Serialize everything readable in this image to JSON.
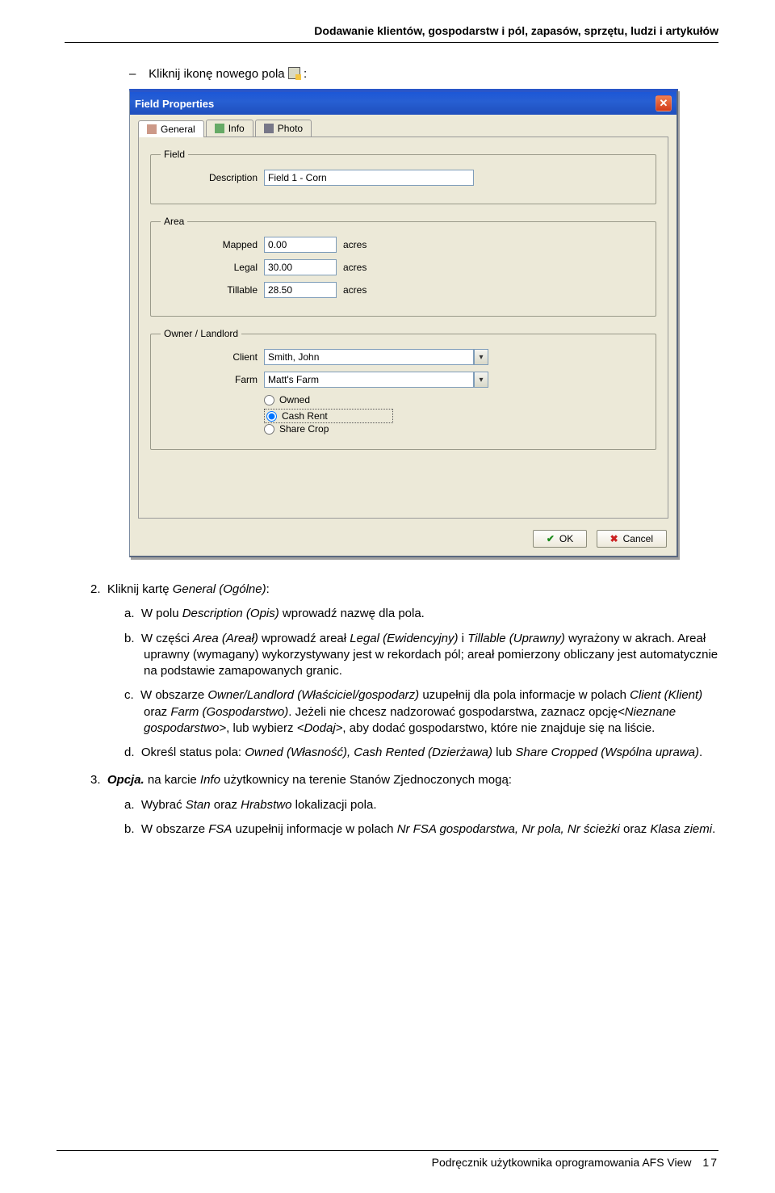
{
  "header": "Dodawanie klientów, gospodarstw i pól, zapasów, sprzętu, ludzi i artykułów",
  "intro": {
    "prefix": "Kliknij ikonę nowego pola",
    "suffix": ":"
  },
  "dialog": {
    "title": "Field Properties",
    "tabs": {
      "general": "General",
      "info": "Info",
      "photo": "Photo"
    },
    "groups": {
      "field": "Field",
      "area": "Area",
      "owner": "Owner / Landlord"
    },
    "labels": {
      "description": "Description",
      "mapped": "Mapped",
      "legal": "Legal",
      "tillable": "Tillable",
      "client": "Client",
      "farm": "Farm"
    },
    "values": {
      "description": "Field 1 - Corn",
      "mapped": "0.00",
      "legal": "30.00",
      "tillable": "28.50",
      "client": "Smith, John",
      "farm": "Matt's Farm"
    },
    "unit": "acres",
    "radios": {
      "owned": "Owned",
      "cashrent": "Cash Rent",
      "sharecrop": "Share Crop"
    },
    "buttons": {
      "ok": "OK",
      "cancel": "Cancel"
    }
  },
  "body": {
    "n2": "2.",
    "t2a": "Kliknij kartę ",
    "t2b": "General (Ogólne)",
    "t2c": ":",
    "na": "a.",
    "ta1": "W polu ",
    "ta2": "Description (Opis)",
    "ta3": " wprowadź nazwę dla pola.",
    "nb": "b.",
    "tb1": "W części ",
    "tb2": "Area (Areał)",
    "tb3": " wprowadź areał ",
    "tb4": "Legal (Ewidencyjny)",
    "tb5": " i ",
    "tb6": "Tillable (Uprawny)",
    "tb7": " wyrażony w akrach. Areał uprawny (wymagany) wykorzystywany jest w rekordach pól; areał pomierzony obliczany jest automatycznie na podstawie zamapowanych granic.",
    "nc": "c.",
    "tc1": "W obszarze ",
    "tc2": "Owner/Landlord (Właściciel/gospodarz)",
    "tc3": " uzupełnij dla pola informacje w polach ",
    "tc4": "Client (Klient)",
    "tc5": " oraz ",
    "tc6": "Farm (Gospodarstwo)",
    "tc7": ". Jeżeli nie chcesz nadzorować gospodarstwa, zaznacz opcję",
    "tc8": "<Nieznane gospodarstwo>",
    "tc9": ", lub wybierz ",
    "tc10": "<Dodaj>",
    "tc11": ", aby dodać gospodarstwo, które nie znajduje się na liście.",
    "nd": "d.",
    "td1": "Określ status pola: ",
    "td2": "Owned (Własność), Cash Rented (Dzierżawa)",
    "td3": " lub ",
    "td4": "Share Cropped (Wspólna uprawa)",
    "td5": ".",
    "n3": "3.",
    "t3a": "Opcja.",
    "t3b": " na karcie ",
    "t3c": "Info",
    "t3d": " użytkownicy na terenie Stanów Zjednoczonych mogą:",
    "n3a": "a.",
    "t3a1": "Wybrać ",
    "t3a2": "Stan",
    "t3a3": " oraz ",
    "t3a4": "Hrabstwo",
    "t3a5": " lokalizacji pola.",
    "n3b": "b.",
    "t3b1": "W obszarze ",
    "t3b2": "FSA",
    "t3b3": " uzupełnij informacje w polach ",
    "t3b4": "Nr FSA gospodarstwa, Nr pola, Nr ścieżki",
    "t3b5": " oraz ",
    "t3b6": "Klasa ziemi",
    "t3b7": "."
  },
  "footer": {
    "text": "Podręcznik użytkownika oprogramowania AFS View",
    "page": "17"
  }
}
